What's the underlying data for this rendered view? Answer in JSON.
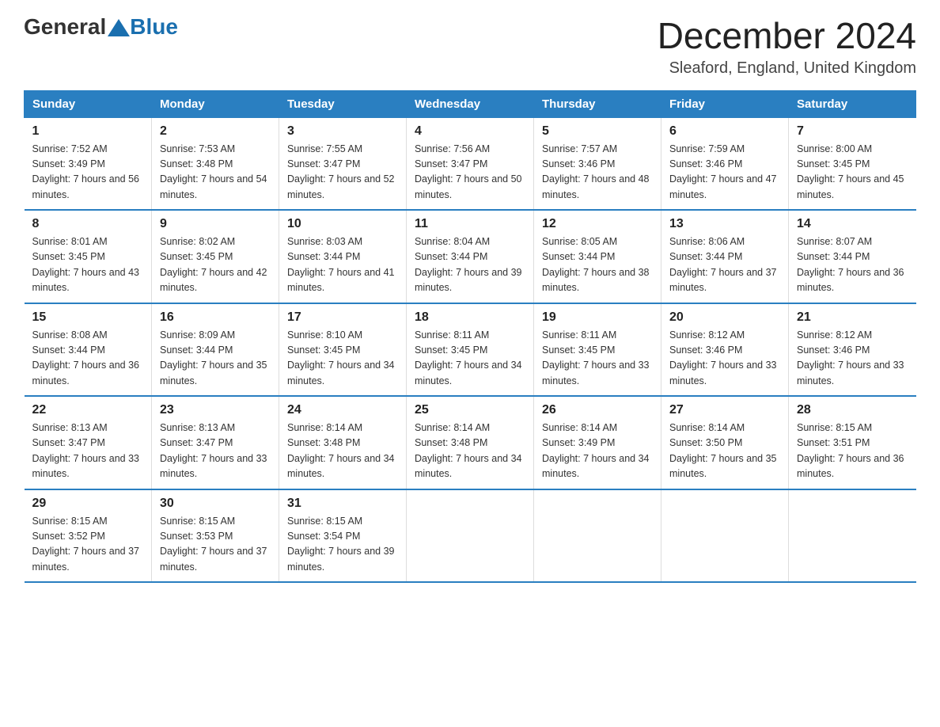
{
  "logo": {
    "general": "General",
    "blue": "Blue"
  },
  "title": "December 2024",
  "location": "Sleaford, England, United Kingdom",
  "headers": [
    "Sunday",
    "Monday",
    "Tuesday",
    "Wednesday",
    "Thursday",
    "Friday",
    "Saturday"
  ],
  "weeks": [
    [
      {
        "day": "1",
        "sunrise": "7:52 AM",
        "sunset": "3:49 PM",
        "daylight": "7 hours and 56 minutes."
      },
      {
        "day": "2",
        "sunrise": "7:53 AM",
        "sunset": "3:48 PM",
        "daylight": "7 hours and 54 minutes."
      },
      {
        "day": "3",
        "sunrise": "7:55 AM",
        "sunset": "3:47 PM",
        "daylight": "7 hours and 52 minutes."
      },
      {
        "day": "4",
        "sunrise": "7:56 AM",
        "sunset": "3:47 PM",
        "daylight": "7 hours and 50 minutes."
      },
      {
        "day": "5",
        "sunrise": "7:57 AM",
        "sunset": "3:46 PM",
        "daylight": "7 hours and 48 minutes."
      },
      {
        "day": "6",
        "sunrise": "7:59 AM",
        "sunset": "3:46 PM",
        "daylight": "7 hours and 47 minutes."
      },
      {
        "day": "7",
        "sunrise": "8:00 AM",
        "sunset": "3:45 PM",
        "daylight": "7 hours and 45 minutes."
      }
    ],
    [
      {
        "day": "8",
        "sunrise": "8:01 AM",
        "sunset": "3:45 PM",
        "daylight": "7 hours and 43 minutes."
      },
      {
        "day": "9",
        "sunrise": "8:02 AM",
        "sunset": "3:45 PM",
        "daylight": "7 hours and 42 minutes."
      },
      {
        "day": "10",
        "sunrise": "8:03 AM",
        "sunset": "3:44 PM",
        "daylight": "7 hours and 41 minutes."
      },
      {
        "day": "11",
        "sunrise": "8:04 AM",
        "sunset": "3:44 PM",
        "daylight": "7 hours and 39 minutes."
      },
      {
        "day": "12",
        "sunrise": "8:05 AM",
        "sunset": "3:44 PM",
        "daylight": "7 hours and 38 minutes."
      },
      {
        "day": "13",
        "sunrise": "8:06 AM",
        "sunset": "3:44 PM",
        "daylight": "7 hours and 37 minutes."
      },
      {
        "day": "14",
        "sunrise": "8:07 AM",
        "sunset": "3:44 PM",
        "daylight": "7 hours and 36 minutes."
      }
    ],
    [
      {
        "day": "15",
        "sunrise": "8:08 AM",
        "sunset": "3:44 PM",
        "daylight": "7 hours and 36 minutes."
      },
      {
        "day": "16",
        "sunrise": "8:09 AM",
        "sunset": "3:44 PM",
        "daylight": "7 hours and 35 minutes."
      },
      {
        "day": "17",
        "sunrise": "8:10 AM",
        "sunset": "3:45 PM",
        "daylight": "7 hours and 34 minutes."
      },
      {
        "day": "18",
        "sunrise": "8:11 AM",
        "sunset": "3:45 PM",
        "daylight": "7 hours and 34 minutes."
      },
      {
        "day": "19",
        "sunrise": "8:11 AM",
        "sunset": "3:45 PM",
        "daylight": "7 hours and 33 minutes."
      },
      {
        "day": "20",
        "sunrise": "8:12 AM",
        "sunset": "3:46 PM",
        "daylight": "7 hours and 33 minutes."
      },
      {
        "day": "21",
        "sunrise": "8:12 AM",
        "sunset": "3:46 PM",
        "daylight": "7 hours and 33 minutes."
      }
    ],
    [
      {
        "day": "22",
        "sunrise": "8:13 AM",
        "sunset": "3:47 PM",
        "daylight": "7 hours and 33 minutes."
      },
      {
        "day": "23",
        "sunrise": "8:13 AM",
        "sunset": "3:47 PM",
        "daylight": "7 hours and 33 minutes."
      },
      {
        "day": "24",
        "sunrise": "8:14 AM",
        "sunset": "3:48 PM",
        "daylight": "7 hours and 34 minutes."
      },
      {
        "day": "25",
        "sunrise": "8:14 AM",
        "sunset": "3:48 PM",
        "daylight": "7 hours and 34 minutes."
      },
      {
        "day": "26",
        "sunrise": "8:14 AM",
        "sunset": "3:49 PM",
        "daylight": "7 hours and 34 minutes."
      },
      {
        "day": "27",
        "sunrise": "8:14 AM",
        "sunset": "3:50 PM",
        "daylight": "7 hours and 35 minutes."
      },
      {
        "day": "28",
        "sunrise": "8:15 AM",
        "sunset": "3:51 PM",
        "daylight": "7 hours and 36 minutes."
      }
    ],
    [
      {
        "day": "29",
        "sunrise": "8:15 AM",
        "sunset": "3:52 PM",
        "daylight": "7 hours and 37 minutes."
      },
      {
        "day": "30",
        "sunrise": "8:15 AM",
        "sunset": "3:53 PM",
        "daylight": "7 hours and 37 minutes."
      },
      {
        "day": "31",
        "sunrise": "8:15 AM",
        "sunset": "3:54 PM",
        "daylight": "7 hours and 39 minutes."
      },
      null,
      null,
      null,
      null
    ]
  ]
}
